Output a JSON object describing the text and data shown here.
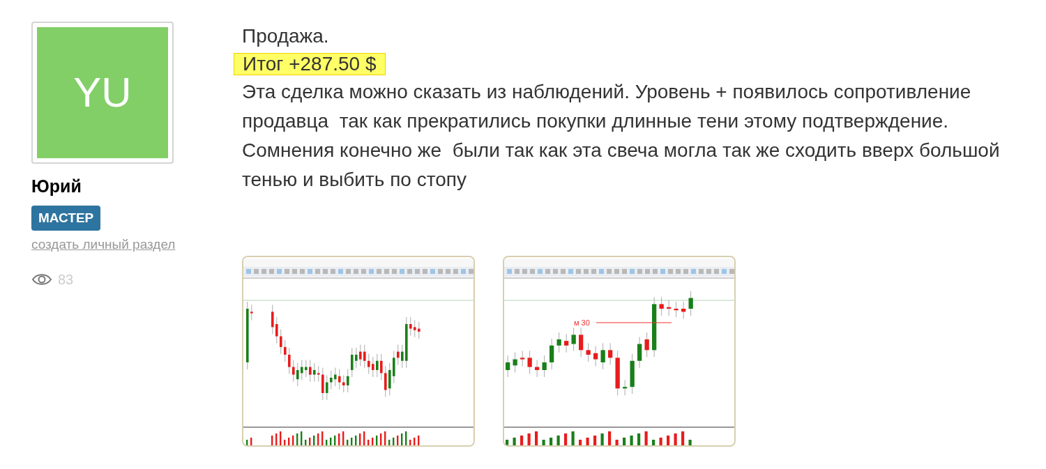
{
  "author": {
    "initials": "YU",
    "name": "Юрий",
    "badge": "МАСТЕР",
    "link": "создать личный раздел",
    "views": "83"
  },
  "post": {
    "title": "Продажа.",
    "result": "Итог +287.50 $",
    "body": "Эта сделка можно сказать из наблюдений. Уровень + появилось сопротивление продавца  так как прекратились покупки длинные тени этому подтверждение. Сомнения конечно же  были так как эта свеча могла так же сходить вверх большой тенью и выбить по стопу"
  },
  "attachments": [
    {
      "kind": "chart-screenshot"
    },
    {
      "kind": "chart-screenshot",
      "label": "м 30"
    }
  ]
}
